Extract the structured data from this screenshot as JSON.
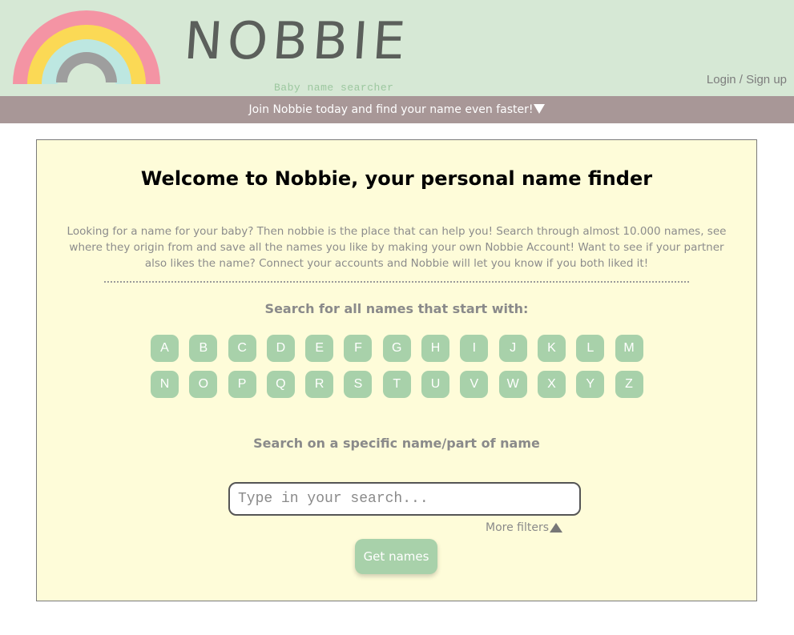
{
  "header": {
    "logo_text": "NOBBIE",
    "tagline": "Baby name searcher",
    "login_label": "Login / Sign up"
  },
  "banner": {
    "text": "Join Nobbie today and find your name even faster!"
  },
  "main": {
    "welcome_title": "Welcome to Nobbie, your personal name finder",
    "intro": "Looking for a name for your baby? Then nobbie is the place that can help you! Search through almost 10.000 names, see where they origin from and save all the names you like by making your own Nobbie Account! Want to see if your partner also likes the name? Connect your accounts and Nobbie will let you know if you both liked it!",
    "letter_heading": "Search for all names that start with:",
    "letters": [
      "A",
      "B",
      "C",
      "D",
      "E",
      "F",
      "G",
      "H",
      "I",
      "J",
      "K",
      "L",
      "M",
      "N",
      "O",
      "P",
      "Q",
      "R",
      "S",
      "T",
      "U",
      "V",
      "W",
      "X",
      "Y",
      "Z"
    ],
    "specific_heading": "Search on a specific name/part of name",
    "search": {
      "placeholder": "Type in your search...",
      "value": ""
    },
    "more_filters_label": "More filters",
    "get_names_label": "Get names"
  },
  "colors": {
    "header_bg": "#d6e8d5",
    "banner_bg": "#a89797",
    "panel_bg": "#fefcd9",
    "accent_green": "#a8d1aa"
  }
}
